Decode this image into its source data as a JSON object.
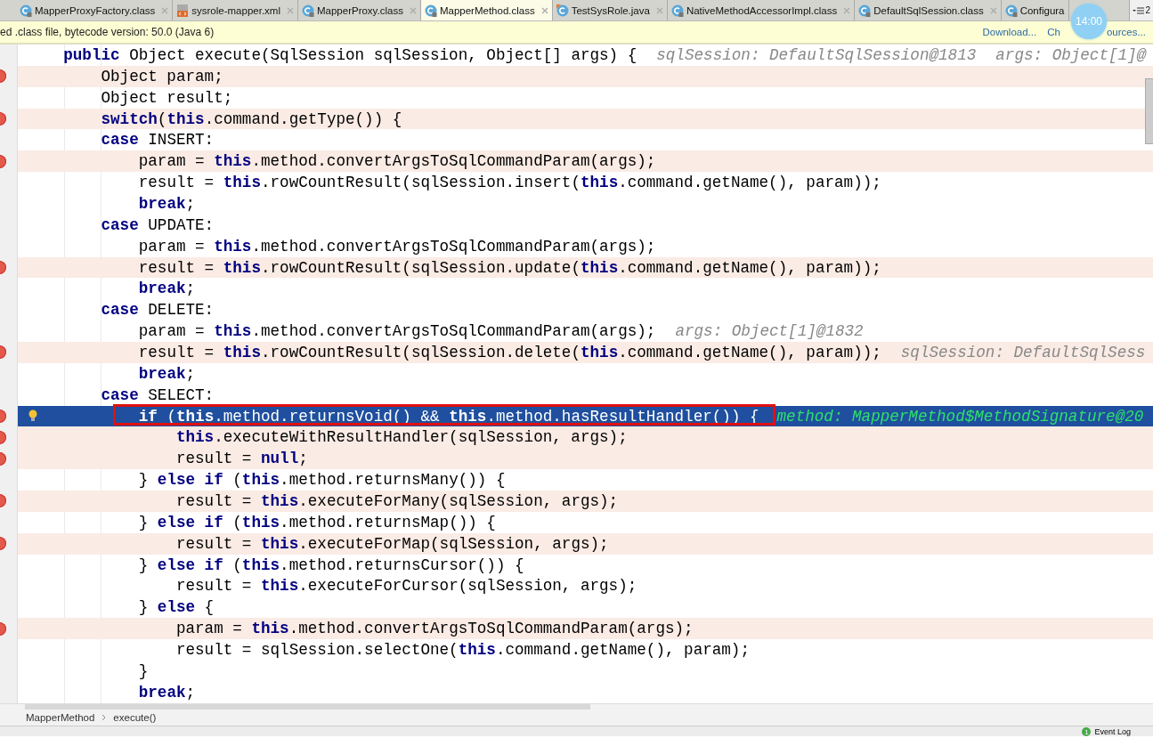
{
  "tabs": [
    {
      "label": "MapperProxyFactory.class",
      "kind": "class",
      "selected": false
    },
    {
      "label": "sysrole-mapper.xml",
      "kind": "xml",
      "selected": false
    },
    {
      "label": "MapperProxy.class",
      "kind": "class",
      "selected": false
    },
    {
      "label": "MapperMethod.class",
      "kind": "class",
      "selected": true
    },
    {
      "label": "TestSysRole.java",
      "kind": "java",
      "selected": false
    },
    {
      "label": "NativeMethodAccessorImpl.class",
      "kind": "class",
      "selected": false
    },
    {
      "label": "DefaultSqlSession.class",
      "kind": "class",
      "selected": false
    },
    {
      "label": "Configura",
      "kind": "class",
      "selected": false
    }
  ],
  "tab_overflow": "2",
  "infobar": {
    "text": "ed .class file, bytecode version: 50.0 (Java 6)",
    "links": [
      "Download...",
      "Ch",
      "ources..."
    ]
  },
  "clock_bubble": "14:00",
  "code_lines": [
    {
      "text": "    **public** Object execute(SqlSession sqlSession, Object[] args) {",
      "breakpoint": false,
      "current": false,
      "hints": [
        "sqlSession: DefaultSqlSession@1813",
        "args: Object[1]@"
      ]
    },
    {
      "text": "        Object param;",
      "breakpoint": true,
      "current": false
    },
    {
      "text": "        Object result;",
      "breakpoint": false,
      "current": false
    },
    {
      "text": "        **switch**(**this**.command.getType()) {",
      "breakpoint": true,
      "current": false
    },
    {
      "text": "        **case** INSERT:",
      "breakpoint": false,
      "current": false
    },
    {
      "text": "            param = **this**.method.convertArgsToSqlCommandParam(args);",
      "breakpoint": true,
      "current": false
    },
    {
      "text": "            result = **this**.rowCountResult(sqlSession.insert(**this**.command.getName(), param));",
      "breakpoint": false,
      "current": false
    },
    {
      "text": "            **break**;",
      "breakpoint": false,
      "current": false
    },
    {
      "text": "        **case** UPDATE:",
      "breakpoint": false,
      "current": false
    },
    {
      "text": "            param = **this**.method.convertArgsToSqlCommandParam(args);",
      "breakpoint": false,
      "current": false
    },
    {
      "text": "            result = **this**.rowCountResult(sqlSession.update(**this**.command.getName(), param));",
      "breakpoint": true,
      "current": false
    },
    {
      "text": "            **break**;",
      "breakpoint": false,
      "current": false
    },
    {
      "text": "        **case** DELETE:",
      "breakpoint": false,
      "current": false
    },
    {
      "text": "            param = **this**.method.convertArgsToSqlCommandParam(args);",
      "breakpoint": false,
      "current": false,
      "hints": [
        "args: Object[1]@1832"
      ]
    },
    {
      "text": "            result = **this**.rowCountResult(sqlSession.delete(**this**.command.getName(), param));",
      "breakpoint": true,
      "current": false,
      "hints": [
        "sqlSession: DefaultSqlSess"
      ]
    },
    {
      "text": "            **break**;",
      "breakpoint": false,
      "current": false
    },
    {
      "text": "        **case** SELECT:",
      "breakpoint": false,
      "current": false
    },
    {
      "text": "            **if** (**this**.method.returnsVoid() && **this**.method.hasResultHandler()) {",
      "breakpoint": true,
      "current": true,
      "annotated": true,
      "hints": [
        "method: MapperMethod$MethodSignature@20"
      ]
    },
    {
      "text": "                **this**.executeWithResultHandler(sqlSession, args);",
      "breakpoint": true,
      "current": false
    },
    {
      "text": "                result = **null**;",
      "breakpoint": true,
      "current": false
    },
    {
      "text": "            } **else if** (**this**.method.returnsMany()) {",
      "breakpoint": false,
      "current": false
    },
    {
      "text": "                result = **this**.executeForMany(sqlSession, args);",
      "breakpoint": true,
      "current": false
    },
    {
      "text": "            } **else if** (**this**.method.returnsMap()) {",
      "breakpoint": false,
      "current": false
    },
    {
      "text": "                result = **this**.executeForMap(sqlSession, args);",
      "breakpoint": true,
      "current": false
    },
    {
      "text": "            } **else if** (**this**.method.returnsCursor()) {",
      "breakpoint": false,
      "current": false
    },
    {
      "text": "                result = **this**.executeForCursor(sqlSession, args);",
      "breakpoint": false,
      "current": false
    },
    {
      "text": "            } **else** {",
      "breakpoint": false,
      "current": false
    },
    {
      "text": "                param = **this**.method.convertArgsToSqlCommandParam(args);",
      "breakpoint": true,
      "current": false
    },
    {
      "text": "                result = sqlSession.selectOne(**this**.command.getName(), param);",
      "breakpoint": false,
      "current": false
    },
    {
      "text": "            }",
      "breakpoint": false,
      "current": false
    },
    {
      "text": "            **break**;",
      "breakpoint": false,
      "current": false
    }
  ],
  "breadcrumb": [
    "MapperMethod",
    "execute()"
  ],
  "event_log": {
    "count": "1",
    "label": "Event Log"
  }
}
